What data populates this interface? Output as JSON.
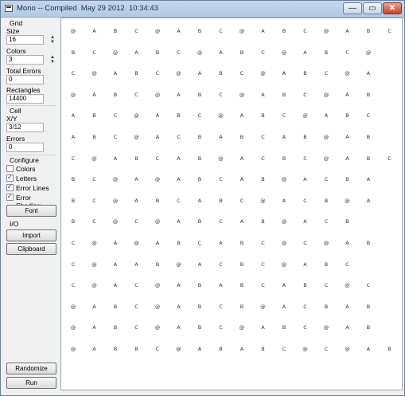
{
  "window": {
    "title": "Mono -- Compiled  May 29 2012  10:34:43",
    "min_glyph": "—",
    "max_glyph": "▭",
    "close_glyph": "✕"
  },
  "sidebar": {
    "grid_heading": "Grid",
    "size_label": "Size",
    "size_value": "16",
    "colors_label": "Colors",
    "colors_value": "3",
    "total_errors_label": "Total Errors",
    "total_errors_value": "0",
    "rectangles_label": "Rectangles",
    "rectangles_value": "14400",
    "cell_heading": "Cell",
    "xy_label": "X/Y",
    "xy_value": "3/12",
    "errors_label": "Errors",
    "errors_value": "0",
    "configure_heading": "Configure",
    "checkboxes": [
      {
        "label": "Colors",
        "checked": false
      },
      {
        "label": "Letters",
        "checked": true
      },
      {
        "label": "Error Lines",
        "checked": true
      },
      {
        "label": "Error Shading",
        "checked": true
      }
    ],
    "font_button": "Font",
    "io_heading": "I/O",
    "import_button": "Import",
    "clipboard_button": "Clipboard",
    "randomize_button": "Randomize",
    "run_button": "Run",
    "check_glyph": "✓",
    "spin_up": "▲",
    "spin_down": "▼"
  },
  "grid": {
    "rows": [
      "@ABC@ABC@ABC@ABC",
      "BC@ABC@ABC@ABC@",
      "C@ABC@ABC@ABC@A",
      "@ABC@ABC@ABC@AB",
      "ABC@ABC@ABC@ABC",
      "ABC@ACBABCAB@AB",
      "C@ABCAB@ACBC@ABC",
      "BC@A@ABCAB@ACBA",
      "BC@ABCABC@ACB@A",
      "BC@C@ABCAB@ACB",
      "C@A@ABCABC@C@AB",
      "C@AAB@ACBC@ABC",
      "C@AC@ABABCABC@C",
      "@ABC@ABCB@ACBAB",
      "@ABC@ABC@ABC@AB",
      "@ABBC@ABABC@C@ABC"
    ]
  }
}
